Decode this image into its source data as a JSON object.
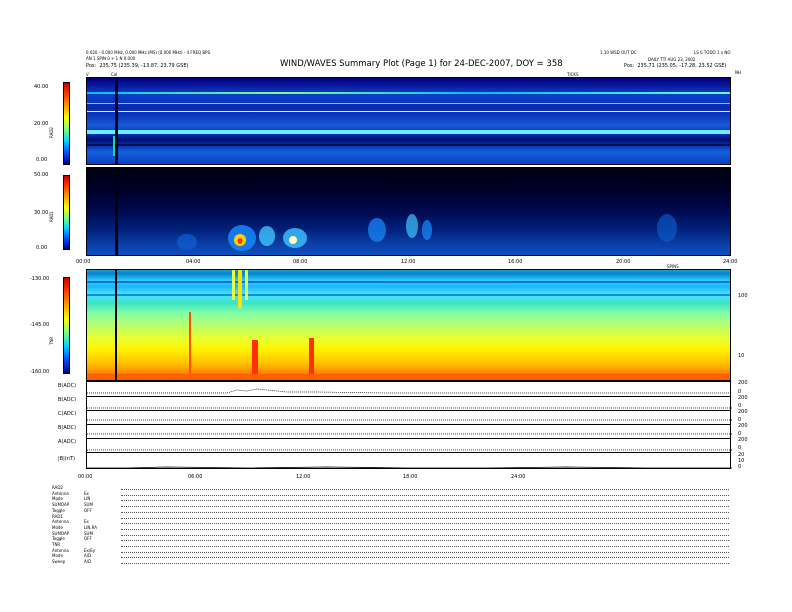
{
  "header": {
    "left_line1": "0.020 - 0.000 MHz, 0.000 MHz (MS) (0.000 MHz) - 4 FREQ BPS",
    "left_line2": "AN 1 SPIN 0 + 1 N 0.000",
    "left_pos_label": "Pos:",
    "left_pos_value": "235.75 (235.39, -13.87, 23.79 GSE)",
    "title": "WIND/WAVES Summary Plot (Page 1) for 24-DEC-2007, DOY = 358",
    "right_line1": "1.10 WSD OUT DC",
    "right_line2": "LS 0 TODO 1 x NO",
    "right_line3": "DAILY TTI AUG 23, 2002",
    "right_pos_label": "Pos:",
    "right_pos_value": "235.71 (235.05, -17.28, 23.52 GSE)",
    "top_marker_left": "V",
    "top_marker_cal": "Cal",
    "top_marker_ticks": "TICKS",
    "top_marker_right": "NH"
  },
  "chart_data": [
    {
      "type": "heatmap",
      "name": "RAD2",
      "ylabel": "RAD2",
      "colorbar_ticks": [
        "40.00",
        "20.00",
        "0.00"
      ],
      "colorbar_range": [
        0,
        40
      ],
      "x_range_hours": [
        0,
        24
      ],
      "notable_features": "persistent narrow-band lines, calibration/gap near 01:15 UT"
    },
    {
      "type": "heatmap",
      "name": "RAD1",
      "ylabel": "RAD1",
      "colorbar_ticks": [
        "50.00",
        "30.00",
        "0.00"
      ],
      "colorbar_range": [
        0,
        50
      ],
      "x_tick_labels": [
        "00:00",
        "04:00",
        "08:00",
        "12:00",
        "16:00",
        "20:00",
        "24:00"
      ],
      "x_unit": "SPINS",
      "notable_features": "enhanced emission bursts between 04:30 and 09:30 UT"
    },
    {
      "type": "heatmap",
      "name": "TNR",
      "ylabel": "TNR",
      "colorbar_ticks": [
        "-130.00",
        "-145.00",
        "-160.00"
      ],
      "colorbar_range": [
        -160,
        -130
      ],
      "right_axis_ticks": [
        "100",
        "10"
      ],
      "notable_features": "vertical bursts near 05:00–09:00 UT, strong low-frequency plasma line"
    },
    {
      "type": "line",
      "name": "Parameters",
      "series": [
        {
          "name": "B(ADC)",
          "right_ticks": [
            "200",
            "0"
          ]
        },
        {
          "name": "B(ADC)",
          "right_ticks": [
            "200",
            "0"
          ]
        },
        {
          "name": "C(ADC)",
          "right_ticks": [
            "200",
            "0"
          ]
        },
        {
          "name": "B(ADC)",
          "right_ticks": [
            "200",
            "0"
          ]
        },
        {
          "name": "A(ADC)",
          "right_ticks": [
            "200",
            "0"
          ]
        },
        {
          "name": "|B|(nT)",
          "right_ticks": [
            "20",
            "10",
            "0"
          ]
        }
      ],
      "x_tick_labels": [
        "00:00",
        "06:00",
        "12:00",
        "18:00",
        "24:00"
      ]
    }
  ],
  "footer": {
    "rows": [
      {
        "label": "RAD2",
        "value": ""
      },
      {
        "label": "Antenna",
        "value": "Ex"
      },
      {
        "label": "Mode",
        "value": "LIN"
      },
      {
        "label": "SUMOAP",
        "value": "SUM"
      },
      {
        "label": "Toggle",
        "value": "OFF"
      },
      {
        "label": "RAD1",
        "value": ""
      },
      {
        "label": "Antenna",
        "value": "Ex"
      },
      {
        "label": "Mode",
        "value": "LIN,RA"
      },
      {
        "label": "SUMOAP",
        "value": "SUM"
      },
      {
        "label": "Toggle",
        "value": "OFF"
      },
      {
        "label": "TNR",
        "value": ""
      },
      {
        "label": "Antenna",
        "value": "Ex/Ey"
      },
      {
        "label": "Mode",
        "value": "A/D"
      },
      {
        "label": "Sweep",
        "value": "A/D"
      }
    ]
  }
}
